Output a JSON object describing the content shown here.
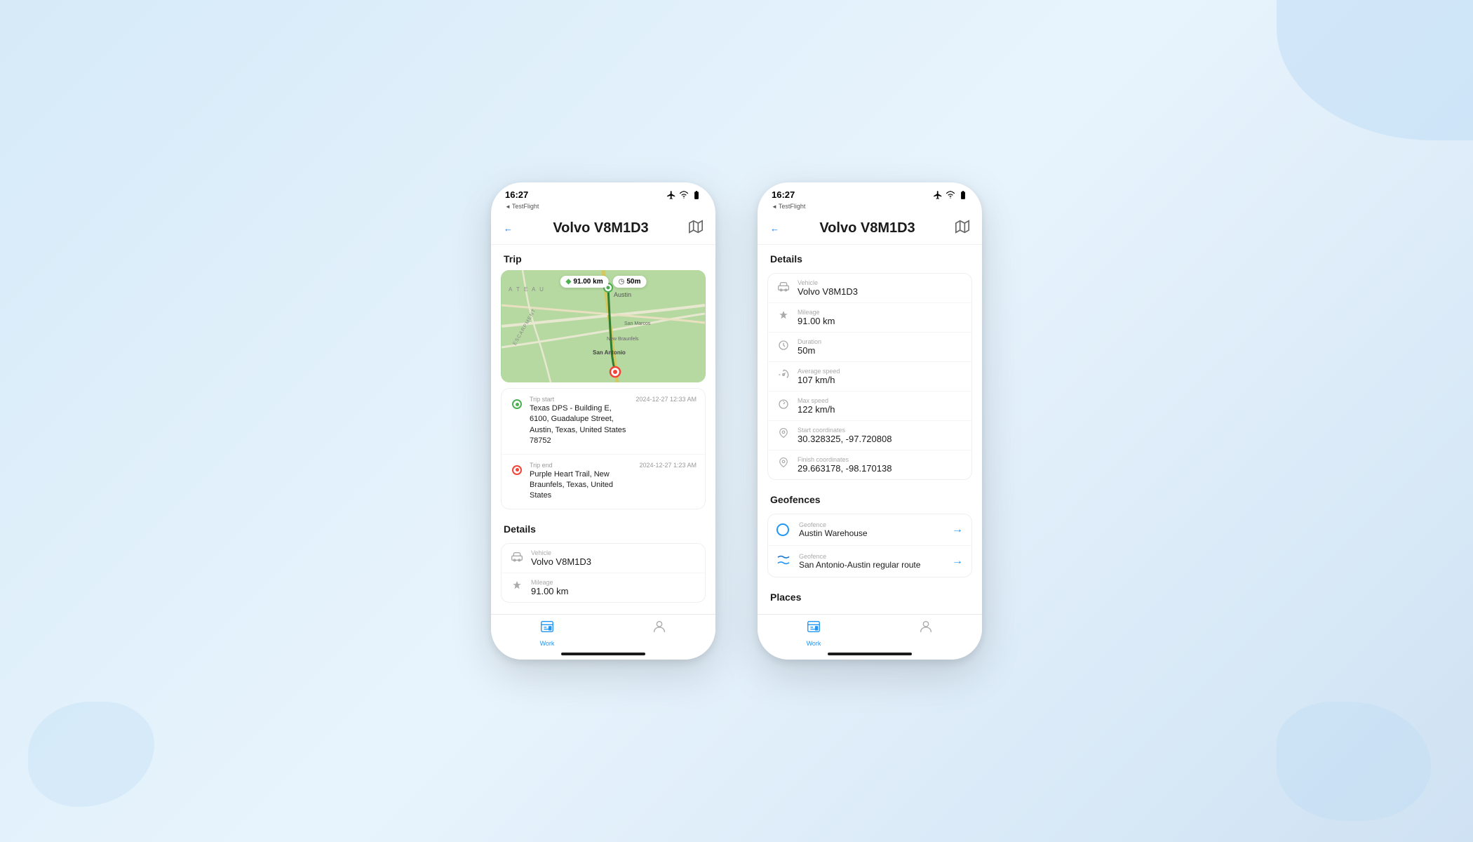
{
  "background": "#d6eaf8",
  "phone1": {
    "statusBar": {
      "time": "16:27",
      "testflight": "TestFlight"
    },
    "header": {
      "back": "",
      "title": "Volvo V8M1D3",
      "mapIcon": "🗺"
    },
    "trip": {
      "sectionTitle": "Trip",
      "mapBadges": {
        "mileage": "91.00 km",
        "duration": "50m"
      },
      "start": {
        "label": "Trip start",
        "time": "2024-12-27 12:33 AM",
        "address": "Texas DPS - Building E, 6100, Guadalupe Street, Austin, Texas, United States 78752"
      },
      "end": {
        "label": "Trip end",
        "time": "2024-12-27 1:23 AM",
        "address": "Purple Heart Trail, New Braunfels, Texas, United States"
      }
    },
    "details": {
      "sectionTitle": "Details",
      "vehicle": {
        "label": "Vehicle",
        "value": "Volvo V8M1D3"
      },
      "mileage": {
        "label": "Mileage",
        "value": "91.00 km"
      }
    },
    "tabBar": {
      "work": {
        "label": "Work",
        "active": true
      },
      "profile": {
        "label": "",
        "active": false
      }
    }
  },
  "phone2": {
    "statusBar": {
      "time": "16:27",
      "testflight": "TestFlight"
    },
    "header": {
      "back": "",
      "title": "Volvo V8M1D3",
      "mapIcon": "🗺"
    },
    "details": {
      "sectionTitle": "Details",
      "items": [
        {
          "label": "Vehicle",
          "value": "Volvo V8M1D3",
          "icon": "car"
        },
        {
          "label": "Mileage",
          "value": "91.00 km",
          "icon": "diamond"
        },
        {
          "label": "Duration",
          "value": "50m",
          "icon": "clock"
        },
        {
          "label": "Average speed",
          "value": "107 km/h",
          "icon": "speed"
        },
        {
          "label": "Max speed",
          "value": "122 km/h",
          "icon": "speedometer"
        },
        {
          "label": "Start coordinates",
          "value": "30.328325, -97.720808",
          "icon": "pin"
        },
        {
          "label": "Finish coordinates",
          "value": "29.663178, -98.170138",
          "icon": "pin"
        }
      ]
    },
    "geofences": {
      "sectionTitle": "Geofences",
      "items": [
        {
          "label": "Geofence",
          "name": "Austin Warehouse",
          "type": "circle"
        },
        {
          "label": "Geofence",
          "name": "San Antonio-Austin regular route",
          "type": "route"
        }
      ]
    },
    "places": {
      "sectionTitle": "Places"
    },
    "tabBar": {
      "work": {
        "label": "Work",
        "active": true
      },
      "profile": {
        "label": "",
        "active": false
      }
    }
  }
}
